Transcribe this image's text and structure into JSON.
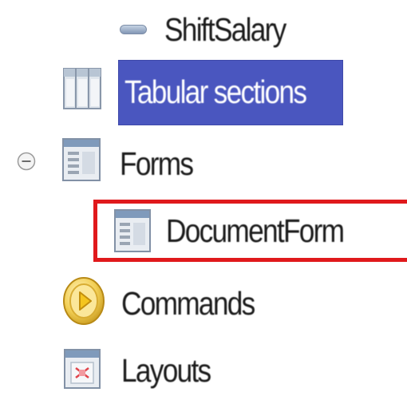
{
  "tree": {
    "items": [
      {
        "label": "ShiftSalary",
        "icon": "attribute-dash-icon"
      },
      {
        "label": "Tabular sections",
        "icon": "tabular-sections-icon",
        "selected": true
      },
      {
        "label": "Forms",
        "icon": "forms-folder-icon",
        "expanded": true,
        "toggle_icon": "collapse-minus-icon"
      },
      {
        "label": "DocumentForm",
        "icon": "document-form-icon",
        "highlighted": true
      },
      {
        "label": "Commands",
        "icon": "commands-icon"
      },
      {
        "label": "Layouts",
        "icon": "layouts-icon"
      }
    ]
  },
  "colors": {
    "selection_bg": "#4a56bf",
    "selection_text": "#ffffff",
    "highlight_border": "#e0191c"
  }
}
